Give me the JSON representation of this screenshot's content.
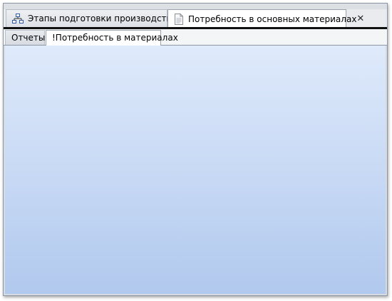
{
  "document_tabs": [
    {
      "label": "Этапы подготовки производства",
      "icon": "hierarchy-icon",
      "active": false
    },
    {
      "label": "Потребность в основных материалах",
      "icon": "document-icon",
      "active": true
    }
  ],
  "sub_tabs": [
    {
      "label": "Отчеты",
      "active": false
    },
    {
      "label": "!Потребность в материалах",
      "active": true
    }
  ],
  "colors": {
    "content_top": "#dfeafb",
    "content_bottom": "#b1c9ee"
  }
}
